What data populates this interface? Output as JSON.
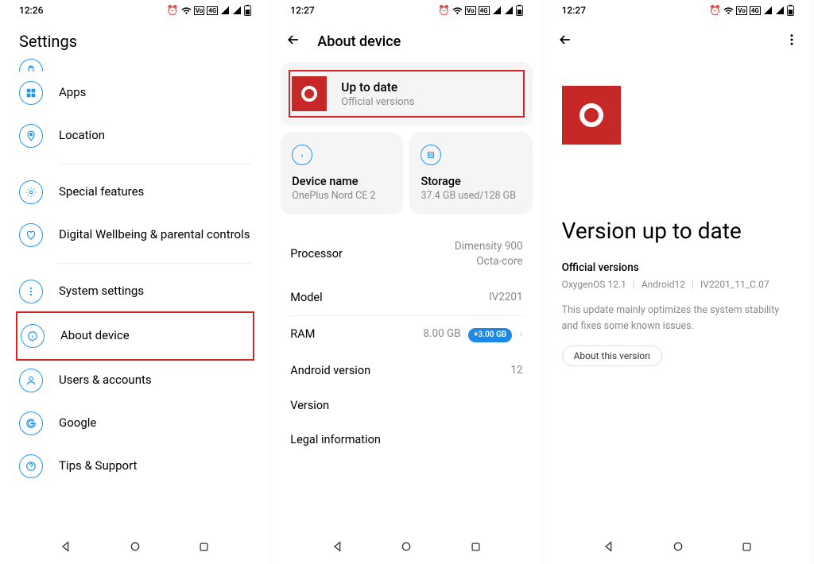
{
  "status": {
    "time1": "12:26",
    "time2": "12:27",
    "time3": "12:27"
  },
  "phone1": {
    "headerTitle": "Settings",
    "items": {
      "apps": "Apps",
      "location": "Location",
      "special": "Special features",
      "wellbeing": "Digital Wellbeing & parental controls",
      "system": "System settings",
      "about": "About device",
      "users": "Users & accounts",
      "google": "Google",
      "tips": "Tips & Support"
    }
  },
  "phone2": {
    "headerTitle": "About device",
    "update": {
      "title": "Up to date",
      "subtitle": "Official versions"
    },
    "tiles": {
      "deviceName": {
        "title": "Device name",
        "sub": "OnePlus Nord CE 2"
      },
      "storage": {
        "title": "Storage",
        "sub": "37.4 GB used/128 GB"
      }
    },
    "rows": {
      "processor": {
        "label": "Processor",
        "valLine1": "Dimensity 900",
        "valLine2": "Octa-core"
      },
      "model": {
        "label": "Model",
        "val": "IV2201"
      },
      "ram": {
        "label": "RAM",
        "val": "8.00 GB",
        "badge": "+3.00 GB"
      },
      "android": {
        "label": "Android version",
        "val": "12"
      },
      "version": {
        "label": "Version"
      },
      "legal": {
        "label": "Legal information"
      }
    }
  },
  "phone3": {
    "title": "Version up to date",
    "sub1": "Official versions",
    "versions": {
      "a": "OxygenOS 12.1",
      "b": "Android12",
      "c": "IV2201_11_C.07"
    },
    "desc": "This update mainly optimizes the system stability and fixes some known issues.",
    "btn": "About this version"
  }
}
